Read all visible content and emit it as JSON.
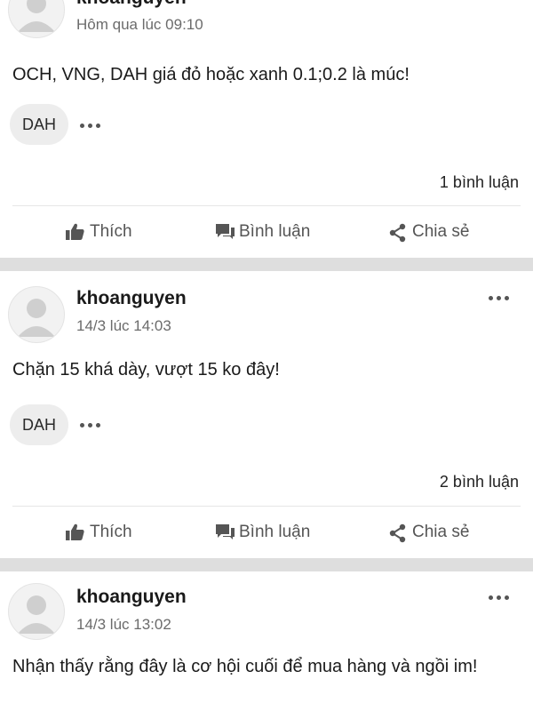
{
  "posts": [
    {
      "username": "khoanguyen",
      "timestamp": "Hôm qua lúc 09:10",
      "content": "OCH, VNG, DAH giá đỏ hoặc xanh 0.1;0.2 là múc!",
      "tag": "DAH",
      "comments": "1 bình luận",
      "actions": {
        "like": "Thích",
        "comment": "Bình luận",
        "share": "Chia sẻ"
      }
    },
    {
      "username": "khoanguyen",
      "timestamp": "14/3 lúc 14:03",
      "content": "Chặn 15 khá dày, vượt 15 ko đây!",
      "tag": "DAH",
      "comments": "2 bình luận",
      "actions": {
        "like": "Thích",
        "comment": "Bình luận",
        "share": "Chia sẻ"
      }
    },
    {
      "username": "khoanguyen",
      "timestamp": "14/3 lúc 13:02",
      "content": "Nhận thấy rằng đây là cơ hội cuối để mua hàng và ngồi im!"
    }
  ],
  "icons": {
    "avatar": "default-user-avatar",
    "more": "more-options-icon",
    "like": "thumbs-up-icon",
    "comment": "comment-bubble-icon",
    "share": "share-icon"
  },
  "colors": {
    "separator": "#dedede",
    "tag_background": "#ededed",
    "meta_text": "#6b6b6b"
  }
}
